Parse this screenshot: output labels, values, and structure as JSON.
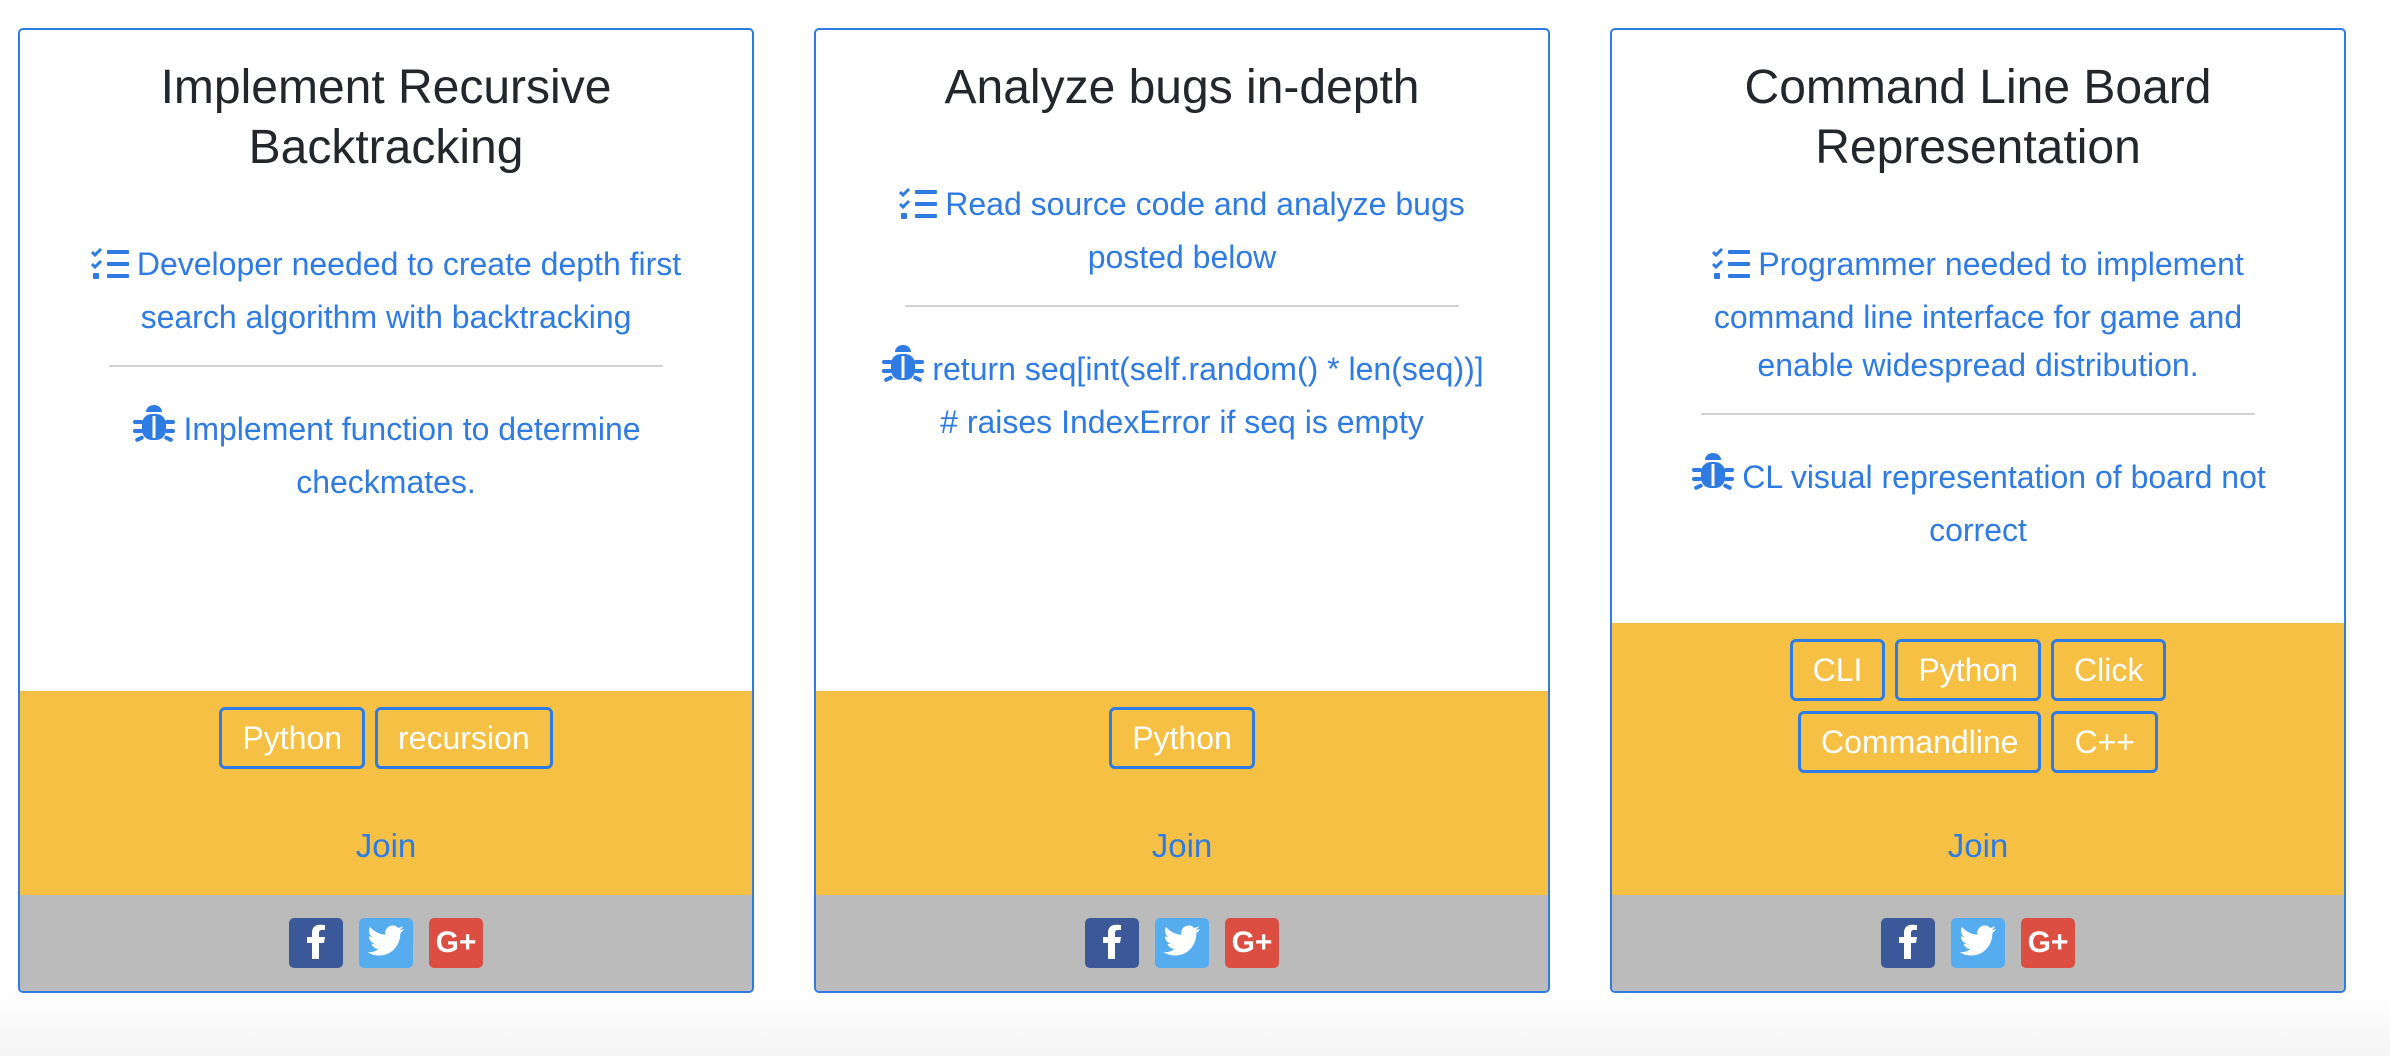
{
  "colors": {
    "accent": "#2f7be4",
    "footer_yellow": "#f5c043",
    "footer_gray": "#bbbbbb"
  },
  "cards": [
    {
      "title": "Implement Recursive Backtracking",
      "task_icon": "checklist-icon",
      "task": "Developer needed to create depth first search algorithm with backtracking",
      "bug_icon": "bug-icon",
      "bug": "Implement function to determine checkmates.",
      "tags": [
        "Python",
        "recursion"
      ],
      "join": "Join",
      "social": [
        "facebook",
        "twitter",
        "google-plus"
      ]
    },
    {
      "title": "Analyze bugs in-depth",
      "task_icon": "checklist-icon",
      "task": "Read source code and analyze bugs posted below",
      "bug_icon": "bug-icon",
      "bug": "return seq[int(self.random() * len(seq))] # raises IndexError if seq is empty",
      "tags": [
        "Python"
      ],
      "join": "Join",
      "social": [
        "facebook",
        "twitter",
        "google-plus"
      ]
    },
    {
      "title": "Command Line Board Representation",
      "task_icon": "checklist-icon",
      "task": "Programmer needed to implement command line interface for game and enable widespread distribution.",
      "bug_icon": "bug-icon",
      "bug": "CL visual representation of board not correct",
      "tags": [
        "CLI",
        "Python",
        "Click",
        "Commandline",
        "C++"
      ],
      "join": "Join",
      "social": [
        "facebook",
        "twitter",
        "google-plus"
      ]
    }
  ]
}
